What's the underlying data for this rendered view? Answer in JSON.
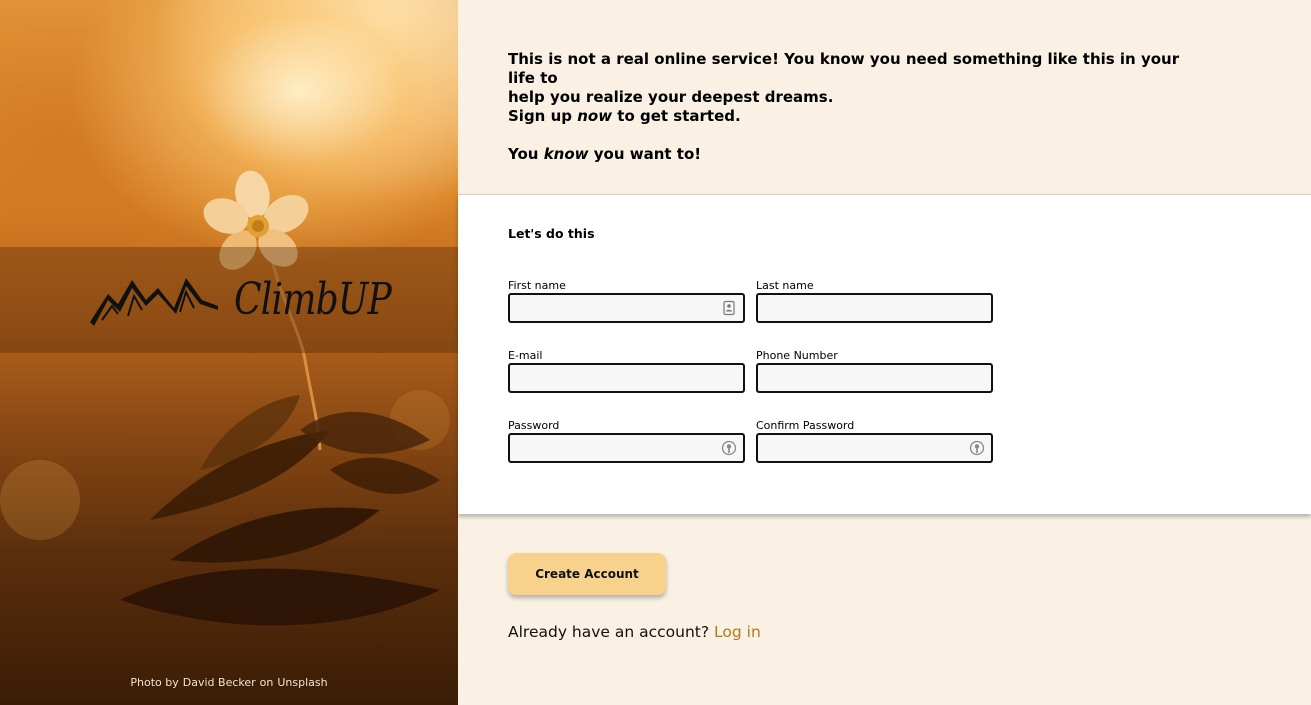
{
  "brand": {
    "name": "ClimbUP",
    "logo_icon": "mountains-icon"
  },
  "photo_credit": {
    "prefix": "Photo by",
    "author": "David Becker",
    "middle": "on",
    "source": "Unsplash"
  },
  "intro": {
    "line1": "This is not a real online service! You know you need something like this in your life to",
    "line2": "help you realize your deepest dreams.",
    "line3_pre": "Sign up ",
    "line3_em": "now",
    "line3_post": " to get started.",
    "line4_pre": "You ",
    "line4_em": "know",
    "line4_post": " you want to!"
  },
  "form": {
    "title": "Let's do this",
    "fields": {
      "first_name": {
        "label": "First name",
        "value": "",
        "icon": "contact-card-icon"
      },
      "last_name": {
        "label": "Last name",
        "value": ""
      },
      "email": {
        "label": "E-mail",
        "value": ""
      },
      "phone": {
        "label": "Phone Number",
        "value": ""
      },
      "password": {
        "label": "Password",
        "value": "",
        "icon": "password-key-icon"
      },
      "confirm_password": {
        "label": "Confirm Password",
        "value": "",
        "icon": "password-key-icon"
      }
    }
  },
  "actions": {
    "create_account": "Create Account",
    "login_prompt": "Already have an account?",
    "login_link": "Log in"
  },
  "colors": {
    "page_bg": "#faf1e4",
    "card_bg": "#ffffff",
    "button_bg": "#f8d28c",
    "link": "#b07a1c",
    "field_border": "#111111"
  }
}
